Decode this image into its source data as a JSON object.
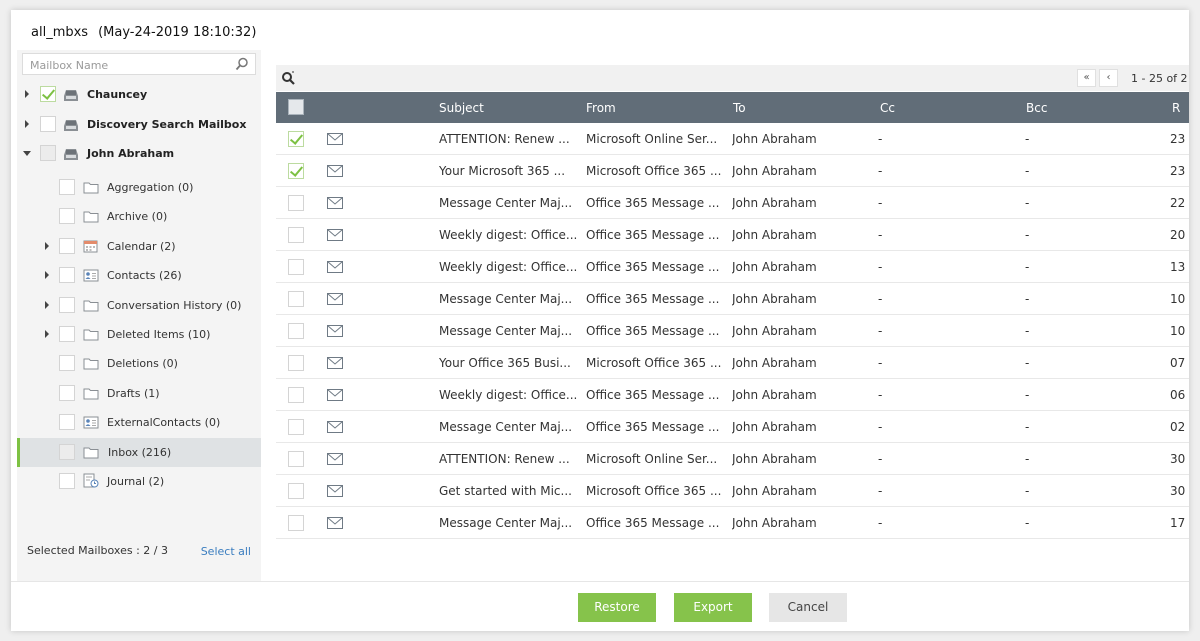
{
  "title": {
    "name": "all_mbxs",
    "snapshot": "(May-24-2019 18:10:32)"
  },
  "left": {
    "search_placeholder": "Mailbox Name",
    "mailboxes": [
      {
        "label": "Chauncey",
        "checked": true
      },
      {
        "label": "Discovery Search Mailbox",
        "checked": false
      },
      {
        "label": "John Abraham",
        "partial": true
      }
    ],
    "folders": [
      {
        "label": "Aggregation (0)",
        "icon": "folder-icon",
        "expandable": false
      },
      {
        "label": "Archive (0)",
        "icon": "folder-icon",
        "expandable": false
      },
      {
        "label": "Calendar (2)",
        "icon": "calendar-icon",
        "expandable": true
      },
      {
        "label": "Contacts (26)",
        "icon": "contacts-icon",
        "expandable": true
      },
      {
        "label": "Conversation History (0)",
        "icon": "folder-icon",
        "expandable": true
      },
      {
        "label": "Deleted Items (10)",
        "icon": "folder-icon",
        "expandable": true
      },
      {
        "label": "Deletions (0)",
        "icon": "folder-icon",
        "expandable": false
      },
      {
        "label": "Drafts (1)",
        "icon": "folder-icon",
        "expandable": false
      },
      {
        "label": "ExternalContacts (0)",
        "icon": "contacts-icon",
        "expandable": false
      },
      {
        "label": "Inbox (216)",
        "icon": "folder-icon",
        "expandable": false,
        "selected": true
      },
      {
        "label": "Journal (2)",
        "icon": "journal-icon",
        "expandable": false
      }
    ],
    "selected_mailboxes": "Selected Mailboxes : 2 / 3",
    "select_all": "Select all"
  },
  "pager": {
    "text": "1 - 25 of 2",
    "first": "«",
    "prev": "‹"
  },
  "table": {
    "headers": [
      "Subject",
      "From",
      "To",
      "Cc",
      "Bcc",
      "R"
    ],
    "rows": [
      {
        "checked": true,
        "subject": "ATTENTION: Renew ...",
        "from": "Microsoft Online Ser...",
        "to": "John Abraham",
        "cc": "-",
        "bcc": "-",
        "r": "23"
      },
      {
        "checked": true,
        "subject": "Your Microsoft 365 ...",
        "from": "Microsoft Office 365 ...",
        "to": "John Abraham",
        "cc": "-",
        "bcc": "-",
        "r": "23"
      },
      {
        "checked": false,
        "subject": "Message Center Maj...",
        "from": "Office 365 Message ...",
        "to": "John Abraham",
        "cc": "-",
        "bcc": "-",
        "r": "22"
      },
      {
        "checked": false,
        "subject": "Weekly digest: Office...",
        "from": "Office 365 Message ...",
        "to": "John Abraham",
        "cc": "-",
        "bcc": "-",
        "r": "20"
      },
      {
        "checked": false,
        "subject": "Weekly digest: Office...",
        "from": "Office 365 Message ...",
        "to": "John Abraham",
        "cc": "-",
        "bcc": "-",
        "r": "13"
      },
      {
        "checked": false,
        "subject": "Message Center Maj...",
        "from": "Office 365 Message ...",
        "to": "John Abraham",
        "cc": "-",
        "bcc": "-",
        "r": "10"
      },
      {
        "checked": false,
        "subject": "Message Center Maj...",
        "from": "Office 365 Message ...",
        "to": "John Abraham",
        "cc": "-",
        "bcc": "-",
        "r": "10"
      },
      {
        "checked": false,
        "subject": "Your Office 365 Busi...",
        "from": "Microsoft Office 365 ...",
        "to": "John Abraham",
        "cc": "-",
        "bcc": "-",
        "r": "07"
      },
      {
        "checked": false,
        "subject": "Weekly digest: Office...",
        "from": "Office 365 Message ...",
        "to": "John Abraham",
        "cc": "-",
        "bcc": "-",
        "r": "06"
      },
      {
        "checked": false,
        "subject": "Message Center Maj...",
        "from": "Office 365 Message ...",
        "to": "John Abraham",
        "cc": "-",
        "bcc": "-",
        "r": "02"
      },
      {
        "checked": false,
        "subject": "ATTENTION: Renew ...",
        "from": "Microsoft Online Ser...",
        "to": "John Abraham",
        "cc": "-",
        "bcc": "-",
        "r": "30"
      },
      {
        "checked": false,
        "subject": "Get started with Mic...",
        "from": "Microsoft Office 365 ...",
        "to": "John Abraham",
        "cc": "-",
        "bcc": "-",
        "r": "30"
      },
      {
        "checked": false,
        "subject": "Message Center Maj...",
        "from": "Office 365 Message ...",
        "to": "John Abraham",
        "cc": "-",
        "bcc": "-",
        "r": "17"
      }
    ]
  },
  "buttons": {
    "restore": "Restore",
    "export": "Export",
    "cancel": "Cancel"
  },
  "colors": {
    "accent_green": "#86c34b",
    "header_bg": "#616d78",
    "link": "#3a7dbf"
  }
}
